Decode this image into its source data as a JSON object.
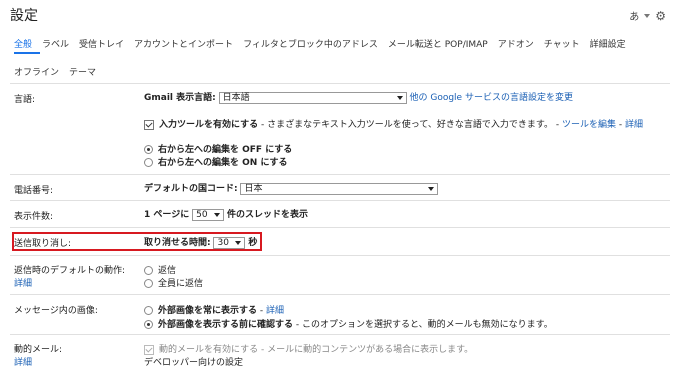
{
  "header": {
    "title": "設定",
    "account_indicator": "あ",
    "gear_icon": "gear-icon"
  },
  "tabs": [
    {
      "label": "全般",
      "active": true
    },
    {
      "label": "ラベル"
    },
    {
      "label": "受信トレイ"
    },
    {
      "label": "アカウントとインポート"
    },
    {
      "label": "フィルタとブロック中のアドレス"
    },
    {
      "label": "メール転送と POP/IMAP"
    },
    {
      "label": "アドオン"
    },
    {
      "label": "チャット"
    },
    {
      "label": "詳細設定"
    }
  ],
  "tabs_row2": [
    {
      "label": "オフライン"
    },
    {
      "label": "テーマ"
    }
  ],
  "language": {
    "label": "言語:",
    "display_label": "Gmail 表示言語:",
    "selected": "日本語",
    "other_services_link": "他の Google サービスの言語設定を変更",
    "input_tools_bold": "入力ツールを有効にする",
    "input_tools_desc": " - さまざまなテキスト入力ツールを使って、好きな言語で入力できます。 - ",
    "edit_tools_link": "ツールを編集",
    "sep": " - ",
    "details_link": "詳細",
    "rtl_off": "右から左への編集を OFF にする",
    "rtl_on": "右から左への編集を ON にする"
  },
  "phone": {
    "label": "電話番号:",
    "country_label": "デフォルトの国コード:",
    "country_selected": "日本"
  },
  "page_size": {
    "label": "表示件数:",
    "prefix": "1 ページに",
    "selected": "50",
    "suffix": "件のスレッドを表示"
  },
  "undo_send": {
    "label": "送信取り消し:",
    "period_label": "取り消せる時間:",
    "selected": "30",
    "unit": "秒"
  },
  "reply_default": {
    "label": "返信時のデフォルトの動作:",
    "details_link": "詳細",
    "opt_reply": "返信",
    "opt_reply_all": "全員に返信"
  },
  "images": {
    "label": "メッセージ内の画像:",
    "opt_always_bold": "外部画像を常に表示する",
    "opt_always_sep": " - ",
    "opt_always_link": "詳細",
    "opt_ask_bold": "外部画像を表示する前に確認する",
    "opt_ask_desc": " - このオプションを選択すると、動的メールも無効になります。"
  },
  "dynamic_mail": {
    "label": "動的メール:",
    "details_link": "詳細",
    "enable_text": "動的メールを有効にする",
    "enable_desc": " - メールに動的コンテンツがある場合に表示します。",
    "developer_link": "デベロッパー向けの設定"
  }
}
